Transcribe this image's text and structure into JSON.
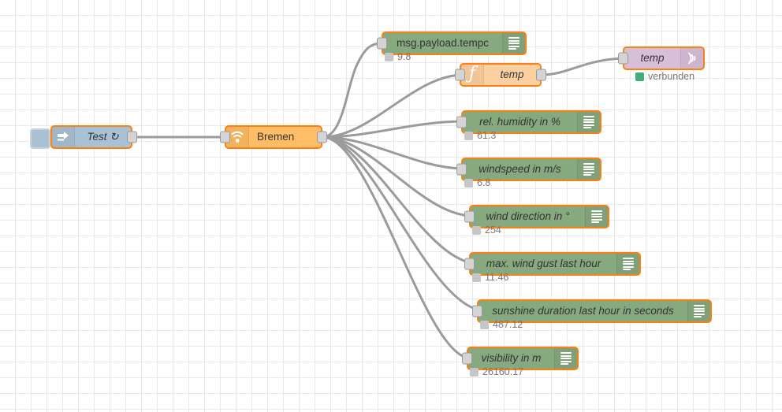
{
  "canvas": {
    "title": "Node-RED flow editor canvas",
    "grid_size": 20,
    "background_color": "#ffffff",
    "grid_color": "#e9e9e9",
    "wire_color": "#9b9b9b"
  },
  "colors": {
    "selected_border": "#ff7f0e",
    "inject_node": "#a8c1d4",
    "weather_node": "#ffbd65",
    "debug_node": "#87a980",
    "function_node": "#fdd0a2",
    "mqtt_node": "#d8bfd8",
    "status_connected": "#3fae7a",
    "status_idle": "#c6c6c6"
  },
  "nodes": {
    "inject": {
      "label": "Test ↻",
      "icon": "inject-arrow-icon",
      "type": "inject"
    },
    "weather": {
      "label": "Bremen",
      "icon": "wifi-signal-icon",
      "type": "weather"
    },
    "function": {
      "label": "temp",
      "icon": "function-f-icon",
      "type": "function"
    },
    "mqtt": {
      "label": "temp",
      "icon": "mqtt-broadcast-icon",
      "type": "mqtt-out",
      "status": "verbunden"
    }
  },
  "debug_nodes": [
    {
      "label": "msg.payload.tempc",
      "italic": false,
      "status": "9.8",
      "icon": "debug-bars-icon"
    },
    {
      "label": "rel. humidity in %",
      "italic": true,
      "status": "61.3",
      "icon": "debug-bars-icon"
    },
    {
      "label": "windspeed in m/s",
      "italic": true,
      "status": "6.8",
      "icon": "debug-bars-icon"
    },
    {
      "label": "wind direction in °",
      "italic": true,
      "status": "254",
      "icon": "debug-bars-icon"
    },
    {
      "label": "max. wind gust last hour",
      "italic": true,
      "status": "11.46",
      "icon": "debug-bars-icon"
    },
    {
      "label": "sunshine duration last hour in seconds",
      "italic": true,
      "status": "487.12",
      "icon": "debug-bars-icon"
    },
    {
      "label": "visibility in m",
      "italic": true,
      "status": "26160.17",
      "icon": "debug-bars-icon"
    }
  ]
}
